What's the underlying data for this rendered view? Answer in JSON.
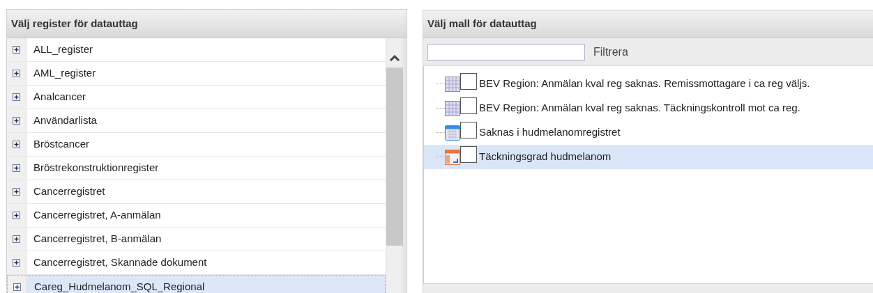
{
  "registers": {
    "title": "Välj register för datauttag",
    "items": [
      {
        "label": "ALL_register",
        "selected": false
      },
      {
        "label": "AML_register",
        "selected": false
      },
      {
        "label": "Analcancer",
        "selected": false
      },
      {
        "label": "Användarlista",
        "selected": false
      },
      {
        "label": "Bröstcancer",
        "selected": false
      },
      {
        "label": "Bröstrekonstruktionregister",
        "selected": false
      },
      {
        "label": "Cancerregistret",
        "selected": false
      },
      {
        "label": "Cancerregistret, A-anmälan",
        "selected": false
      },
      {
        "label": "Cancerregistret, B-anmälan",
        "selected": false
      },
      {
        "label": "Cancerregistret, Skannade dokument",
        "selected": false
      },
      {
        "label": "Careg_Hudmelanom_SQL_Regional",
        "selected": true
      }
    ]
  },
  "templates": {
    "title": "Välj mall för datauttag",
    "filter_label": "Filtrera",
    "items": [
      {
        "label": "BEV Region: Anmälan kval reg saknas. Remissmottagare i ca reg väljs.",
        "kind": "grid",
        "checked": false,
        "selected": false
      },
      {
        "label": "BEV Region: Anmälan kval reg saknas. Täckningskontroll mot ca reg.",
        "kind": "grid",
        "checked": false,
        "selected": false
      },
      {
        "label": "Saknas i hudmelanomregistret",
        "kind": "calendar",
        "checked": false,
        "selected": false
      },
      {
        "label": "Täckningsgrad hudmelanom",
        "kind": "report",
        "checked": false,
        "selected": true
      }
    ]
  }
}
